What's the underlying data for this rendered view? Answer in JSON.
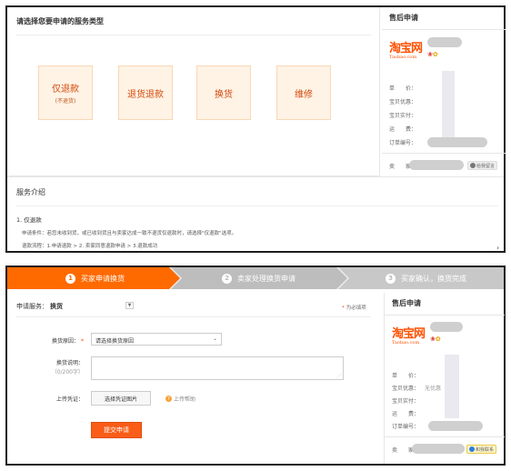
{
  "panel1": {
    "section_title": "请选择您要申请的服务类型",
    "services": [
      {
        "label": "仅退款",
        "sub": "(不退货)"
      },
      {
        "label": "退货退款",
        "sub": ""
      },
      {
        "label": "换货",
        "sub": ""
      },
      {
        "label": "维修",
        "sub": ""
      }
    ],
    "aside": {
      "title": "售后申请",
      "logo_cn": "淘宝网",
      "logo_en": "Taobao.com",
      "rows": [
        "单　　价：",
        "宝贝优惠：",
        "宝贝实付：",
        "运　　费：",
        "订单编号："
      ],
      "seller_label": "卖　　家：",
      "wangwang_label": "给我留言"
    },
    "intro": {
      "title": "服务介绍",
      "subtitle": "1. 仅退款",
      "line1": "申请条件：若您未收到货，或已收到货且与卖家达成一致不退货仅退款时，请选择\"仅退款\"选项。",
      "line2": "退款流程：1.申请退款 > 2. 卖家同意退款申请 > 3.退款成功"
    },
    "comma_mark": "，"
  },
  "panel2": {
    "steps": [
      {
        "num": "1",
        "label": "买家申请换货"
      },
      {
        "num": "2",
        "label": "卖家处理换货申请"
      },
      {
        "num": "3",
        "label": "买家确认，换货完成"
      }
    ],
    "service_label": "申请服务：",
    "service_value": "换货",
    "required_note": "为必填项",
    "form": {
      "reason_label": "换货原因：",
      "reason_placeholder": "请选择换货原因",
      "desc_label": "换货说明：",
      "desc_hint": "（0/200字）",
      "upload_label": "上传凭证：",
      "upload_button": "选择凭证图片",
      "upload_help": "上传帮助",
      "submit": "提交申请"
    },
    "aside": {
      "title": "售后申请",
      "logo_cn": "淘宝网",
      "logo_en": "Taobao.com",
      "rows": [
        "单　　价：",
        "宝贝优惠：",
        "宝贝实付：",
        "运　　费：",
        "订单编号："
      ],
      "discount_value": "无优惠",
      "seller_label": "卖　　家：",
      "wangwang_label": "和我联系"
    }
  },
  "colors": {
    "accent_orange": "#ff6a00",
    "tile_bg": "#fff3e5",
    "tile_text": "#d54a0c",
    "submit_bg": "#f95d17",
    "step_inactive": "#bdbdbd"
  },
  "icons": [
    "shield-flower-icon",
    "question-icon",
    "dropdown-caret-icon",
    "wangwang-icon",
    "resize-grip-icon"
  ]
}
